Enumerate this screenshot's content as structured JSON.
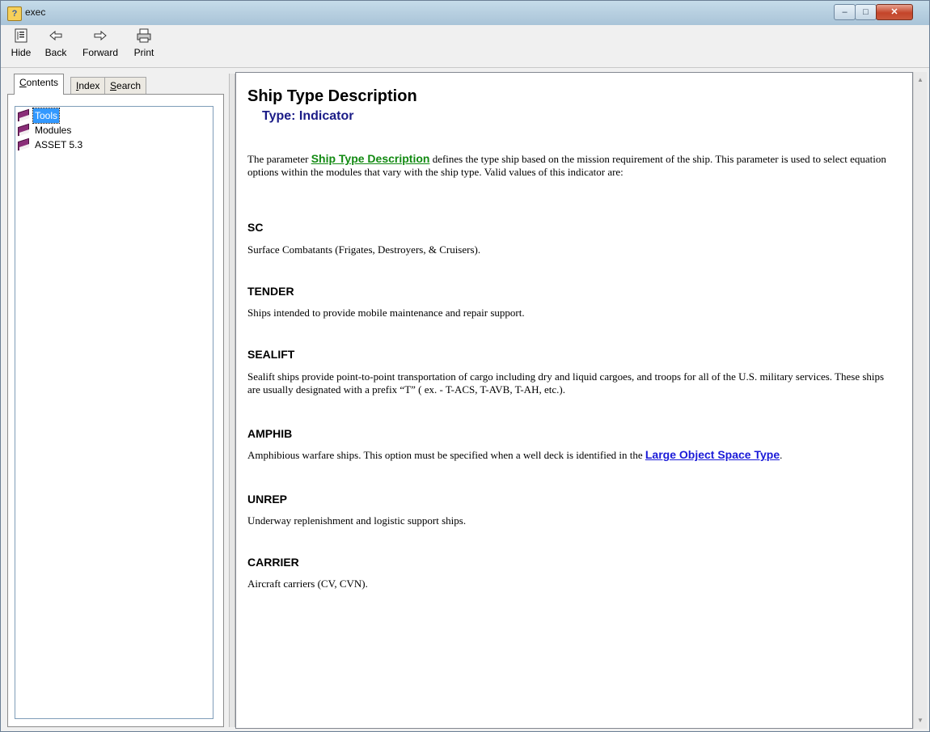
{
  "window": {
    "title": "exec",
    "controls": {
      "minimize": "–",
      "maximize": "□",
      "close": "✕"
    }
  },
  "toolbar": {
    "hide_label": "Hide",
    "back_label": "Back",
    "forward_label": "Forward",
    "print_label": "Print",
    "icons": {
      "hide": "hide-pane-icon",
      "back": "arrow-left-icon",
      "forward": "arrow-right-icon",
      "print": "printer-icon"
    }
  },
  "nav": {
    "tabs": [
      {
        "pre": "",
        "u": "C",
        "post": "ontents"
      },
      {
        "pre": "",
        "u": "I",
        "post": "ndex"
      },
      {
        "pre": "",
        "u": "S",
        "post": "earch"
      }
    ],
    "active_tab": "Contents",
    "tree": [
      {
        "label": "Tools",
        "selected": true
      },
      {
        "label": "Modules",
        "selected": false
      },
      {
        "label": "ASSET 5.3",
        "selected": false
      }
    ]
  },
  "content": {
    "title": "Ship Type Description",
    "subtitle": "Type: Indicator",
    "intro": {
      "prefix": "The parameter ",
      "link": "Ship Type Description",
      "suffix": " defines the type ship based on the mission requirement of the ship.  This parameter is used to select equation options within the modules that vary with the ship type.  Valid values of this indicator are:"
    },
    "sections": [
      {
        "heading": "SC",
        "text": "Surface Combatants (Frigates, Destroyers, & Cruisers)."
      },
      {
        "heading": "TENDER",
        "text": "Ships intended to provide mobile maintenance and repair support."
      },
      {
        "heading": "SEALIFT",
        "text": "Sealift ships  provide point-to-point transportation of cargo including dry and liquid cargoes, and troops for all of the U.S. military services. These ships are usually designated with a prefix “T” ( ex. - T-ACS, T-AVB, T-AH, etc.)."
      },
      {
        "heading": "AMPHIB",
        "text_prefix": "Amphibious warfare ships. This option must be specified when a well deck is identified in the ",
        "link": "Large Object Space Type",
        "text_suffix": "."
      },
      {
        "heading": "UNREP",
        "text": "Underway replenishment and logistic support ships."
      },
      {
        "heading": "CARRIER",
        "text": "Aircraft carriers (CV, CVN)."
      }
    ]
  },
  "colors": {
    "link_green": "#128a12",
    "link_blue": "#1a1ad8",
    "subtitle": "#1b1c87",
    "selection": "#3399ff"
  }
}
